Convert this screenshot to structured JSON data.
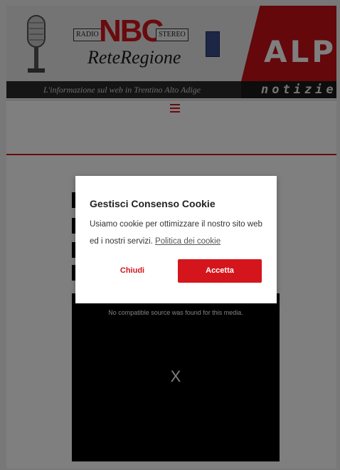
{
  "header": {
    "logo": {
      "radio_label": "RADIO",
      "nbc_label": "NBC",
      "stereo_label": "STEREO",
      "rete_label": "ReteRegione"
    },
    "tagline": "L'informazione sul web in Trentino Alto Adige",
    "alpi_label": "ALPI",
    "notizie_label": "notizie .i",
    "menu_icon": "hamburger-icon"
  },
  "video": {
    "error_message": "No compatible source was found for this media.",
    "close_label": "X"
  },
  "cookie_dialog": {
    "title": "Gestisci Consenso Cookie",
    "body": "Usiamo cookie per ottimizzare il nostro sito web ed i nostri servizi.",
    "policy_link": "Politica dei cookie",
    "close_button": "Chiudi",
    "accept_button": "Accetta"
  },
  "colors": {
    "accent": "#d4161c",
    "overlay": "rgba(0,0,0,0.5)"
  }
}
